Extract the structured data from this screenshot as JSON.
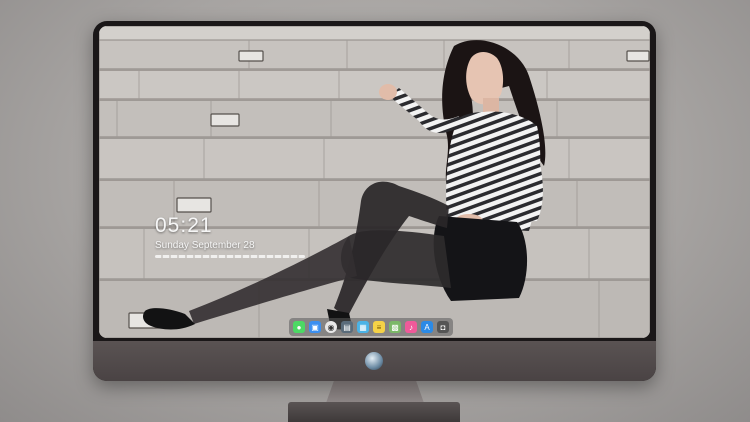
{
  "lock_screen": {
    "time": "05:21",
    "date": "Sunday September 28"
  },
  "dock": {
    "icons": [
      {
        "name": "messages-icon",
        "color": "#4cd964"
      },
      {
        "name": "finder-icon",
        "color": "#3b8ff0"
      },
      {
        "name": "chrome-icon",
        "color": "#e8e8e8"
      },
      {
        "name": "clapper-icon",
        "color": "#5a6b7a"
      },
      {
        "name": "movie-icon",
        "color": "#4bb3e6"
      },
      {
        "name": "notes-icon",
        "color": "#f5d247"
      },
      {
        "name": "photos-icon",
        "color": "#7bb868"
      },
      {
        "name": "music-icon",
        "color": "#f05a9a"
      },
      {
        "name": "app-store-icon",
        "color": "#2b8ae6"
      },
      {
        "name": "camera-icon",
        "color": "#555555"
      }
    ]
  },
  "colors": {
    "monitor_bezel": "#1a1718",
    "chin": "#4f4849",
    "steps": "#c9c5c1"
  }
}
